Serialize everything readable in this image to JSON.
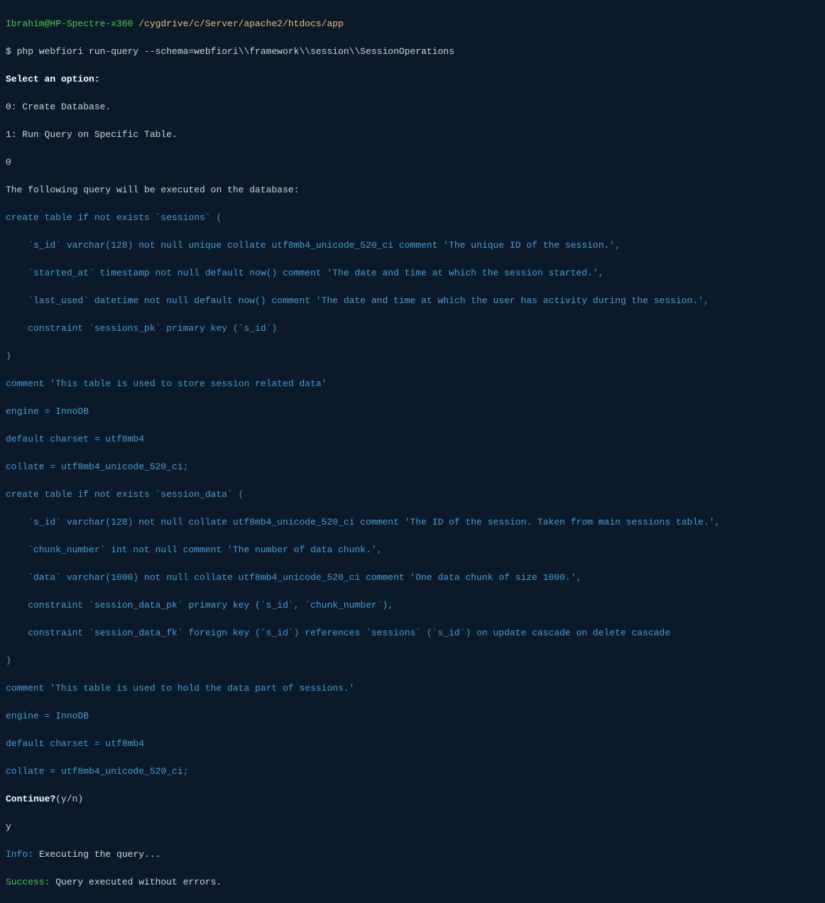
{
  "prompt": {
    "user_host": "Ibrahim@HP-Spectre-x360 ",
    "path": "/cygdrive/c/Server/apache2/htdocs/app"
  },
  "command": "$ php webfiori run-query --schema=webfiori\\\\framework\\\\session\\\\SessionOperations",
  "select_option": "Select an option:",
  "option0": "0: Create Database.",
  "option1": "1: Run Query on Specific Table.",
  "input0": "0",
  "following_query": "The following query will be executed on the database:",
  "sql_line_01": "create table if not exists `sessions` (",
  "sql_line_02": "    `s_id` varchar(128) not null unique collate utf8mb4_unicode_520_ci comment 'The unique ID of the session.',",
  "sql_line_03": "    `started_at` timestamp not null default now() comment 'The date and time at which the session started.',",
  "sql_line_04": "    `last_used` datetime not null default now() comment 'The date and time at which the user has activity during the session.',",
  "sql_line_05": "    constraint `sessions_pk` primary key (`s_id`)",
  "sql_line_06": ")",
  "sql_line_07": "comment 'This table is used to store session related data'",
  "sql_line_08": "engine = InnoDB",
  "sql_line_09": "default charset = utf8mb4",
  "sql_line_10": "collate = utf8mb4_unicode_520_ci;",
  "sql_line_11": "create table if not exists `session_data` (",
  "sql_line_12": "    `s_id` varchar(128) not null collate utf8mb4_unicode_520_ci comment 'The ID of the session. Taken from main sessions table.',",
  "sql_line_13": "    `chunk_number` int not null comment 'The number of data chunk.',",
  "sql_line_14": "    `data` varchar(1000) not null collate utf8mb4_unicode_520_ci comment 'One data chunk of size 1000.',",
  "sql_line_15": "    constraint `session_data_pk` primary key (`s_id`, `chunk_number`),",
  "sql_line_16": "    constraint `session_data_fk` foreign key (`s_id`) references `sessions` (`s_id`) on update cascade on delete cascade",
  "sql_line_17": ")",
  "sql_line_18": "comment 'This table is used to hold the data part of sessions.'",
  "sql_line_19": "engine = InnoDB",
  "sql_line_20": "default charset = utf8mb4",
  "sql_line_21": "collate = utf8mb4_unicode_520_ci;",
  "continue_prompt_label": "Continue?",
  "continue_prompt_options": "(y/n)",
  "input_y": "y",
  "info_label": "Info:",
  "info_text": " Executing the query...",
  "success_label": "Success:",
  "success_text": " Query executed without errors."
}
